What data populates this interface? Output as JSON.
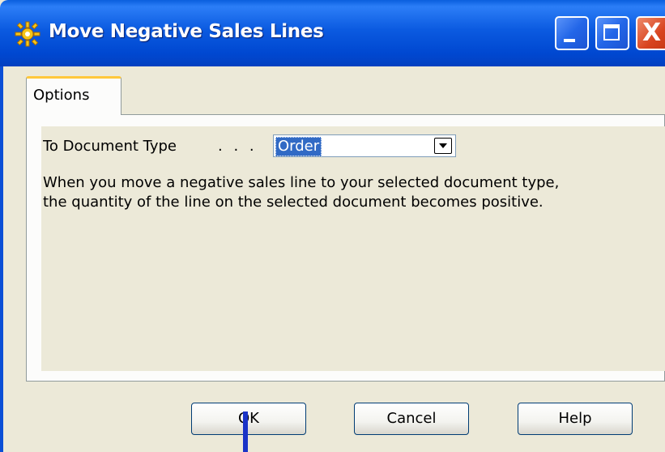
{
  "window": {
    "title": "Move Negative Sales Lines",
    "title_icon": "sun-gear-icon",
    "controls": {
      "minimize": "minimize-icon",
      "maximize": "maximize-icon",
      "close": "close-icon",
      "close_glyph": "X"
    }
  },
  "tabs": [
    {
      "label": "Options",
      "active": true
    }
  ],
  "form": {
    "field_label": "To Document Type",
    "field_dots": ". . .",
    "document_type": {
      "value": "Order",
      "selected": true
    },
    "description": "When you move a negative sales line to your selected document type, the quantity of the line on the selected document becomes positive."
  },
  "buttons": {
    "ok": "OK",
    "cancel": "Cancel",
    "help": "Help"
  },
  "colors": {
    "titlebar": "#0b5ae0",
    "tab_accent": "#ffc83c",
    "selection": "#316ac5",
    "close_button": "#d8441f",
    "face": "#ece9d8"
  }
}
